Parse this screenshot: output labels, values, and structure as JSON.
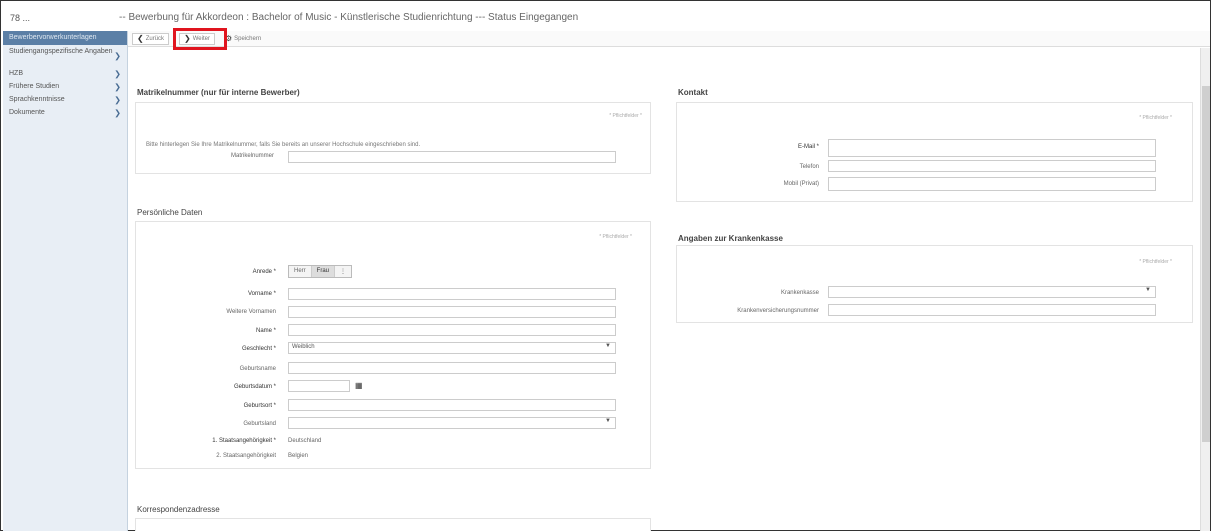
{
  "app_id": "78 ...",
  "page_title": "-- Bewerbung für Akkordeon : Bachelor of Music - Künstlerische Studienrichtung --- Status Eingegangen",
  "sidebar": {
    "items": [
      {
        "label": "Bewerbervorwerkunterlagen",
        "active": true
      },
      {
        "label": "Studiengangspezifische Angaben",
        "active": false
      },
      {
        "label": "HZB",
        "active": false
      },
      {
        "label": "Frühere Studien",
        "active": false
      },
      {
        "label": "Sprachkenntnisse",
        "active": false
      },
      {
        "label": "Dokumente",
        "active": false
      }
    ]
  },
  "toolbar": {
    "back_label": "Zurück",
    "next_label": "Weiter",
    "save_label": "Speichern"
  },
  "matrikel": {
    "title": "Matrikelnummer (nur für interne Bewerber)",
    "pflicht": "* Pflichtfelder *",
    "hint": "Bitte hinterlegen Sie Ihre Matrikelnummer, falls Sie bereits an unserer Hochschule eingeschrieben sind.",
    "label": "Matrikelnummer",
    "value": ""
  },
  "personal": {
    "title": "Persönliche Daten",
    "pflicht": "* Pflichtfelder *",
    "anrede_label": "Anrede *",
    "anrede_options": [
      "Herr",
      "Frau"
    ],
    "vorname_label": "Vorname *",
    "weitere_label": "Weitere Vornamen",
    "name_label": "Name *",
    "geschlecht_label": "Geschlecht *",
    "geschlecht_value": "Weiblich",
    "geburtsname_label": "Geburtsname",
    "geburtsdatum_label": "Geburtsdatum *",
    "geburtsort_label": "Geburtsort *",
    "geburtsland_label": "Geburtsland",
    "staat1_label": "1. Staatsangehörigkeit *",
    "staat1_value": "Deutschland",
    "staat2_label": "2. Staatsangehörigkeit",
    "staat2_value": "Belgien"
  },
  "korrespondenz": {
    "title": "Korrespondenzadresse"
  },
  "kontakt": {
    "title": "Kontakt",
    "pflicht": "* Pflichtfelder *",
    "email_label": "E-Mail *",
    "telefon_label": "Telefon",
    "mobil_label": "Mobil (Privat)"
  },
  "krankenkasse": {
    "title": "Angaben zur Krankenkasse",
    "pflicht": "* Pflichtfelder *",
    "kasse_label": "Krankenkasse",
    "versnr_label": "Krankenversicherungsnummer"
  }
}
